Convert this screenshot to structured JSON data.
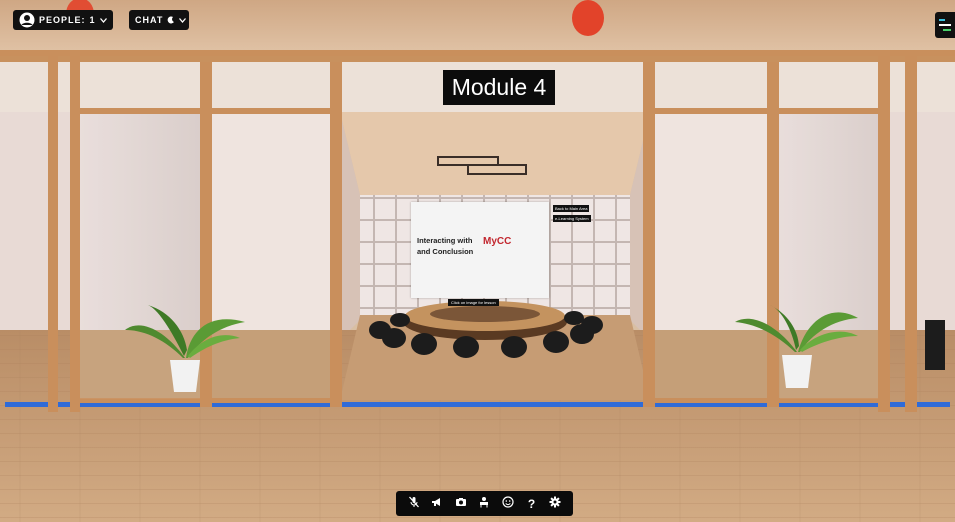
{
  "hud": {
    "people_label": "PEOPLE:",
    "people_count": "1",
    "chat_label": "CHAT"
  },
  "room": {
    "module_sign": "Module 4"
  },
  "presentation": {
    "title_line1": "Interacting with",
    "title_line2": "and Conclusion",
    "brand": "MyCC",
    "back_button": "Back to Main Area",
    "elearning_button": "e-Learning System",
    "click_hint": "Click on image for lesson"
  },
  "toolbar": {
    "help_glyph": "?"
  },
  "colors": {
    "wood_frame": "#c98f5c",
    "floor": "#c49a72",
    "accent_blue": "#2f6bd8",
    "hud_bg": "#111111",
    "brand_red": "#c2262e"
  }
}
